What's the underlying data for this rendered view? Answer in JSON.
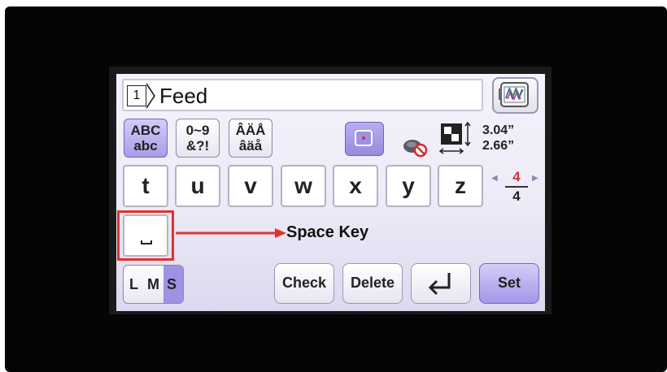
{
  "name_bar": {
    "index": "1",
    "text": "Feed"
  },
  "mode_buttons": [
    {
      "line1": "ABC",
      "line2": "abc",
      "active": true
    },
    {
      "line1": "0~9",
      "line2": "&?!",
      "active": false
    },
    {
      "line1": "ÂÄÅ",
      "line2": "âäå",
      "active": false
    }
  ],
  "dimensions": {
    "height": "3.04”",
    "width": "2.66”"
  },
  "keys": [
    "t",
    "u",
    "v",
    "w",
    "x",
    "y",
    "z"
  ],
  "pager": {
    "current": "4",
    "total": "4"
  },
  "annotation": {
    "label": "Space Key",
    "color": "#e2322c"
  },
  "bottom": {
    "lms": {
      "l": "L",
      "m": "M",
      "s": "S"
    },
    "check": "Check",
    "delete": "Delete",
    "set": "Set"
  },
  "colors": {
    "accent": "#a99de8",
    "highlight": "#e2322c"
  },
  "icons": [
    "embroidery-preview-icon",
    "frame-icon",
    "thread-cut-icon",
    "size-icon",
    "space-icon",
    "enter-icon"
  ]
}
